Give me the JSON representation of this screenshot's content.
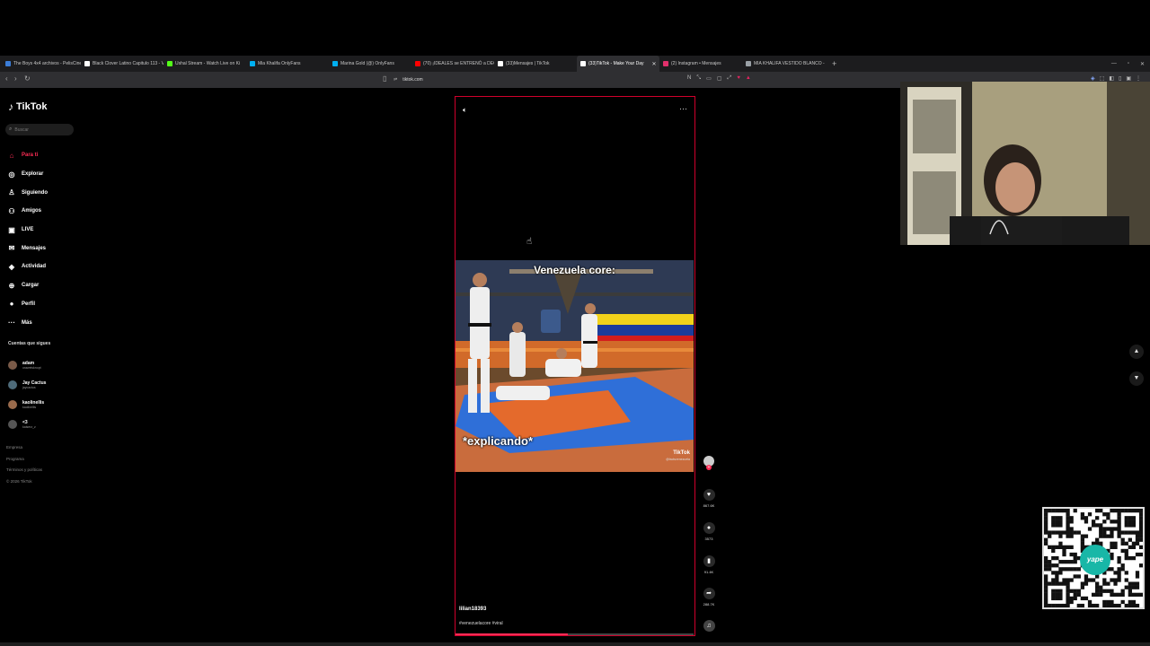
{
  "browser": {
    "tabs": [
      {
        "label": "The Boys 4x4 archivos - PelisCine HD",
        "color": "#3b7dd8",
        "active": false
      },
      {
        "label": "Black Clover Latino Capitulo 113 - Ve",
        "color": "#ffffff",
        "active": false
      },
      {
        "label": "Ushal Stream - Watch Live on Ki",
        "color": "#53fc18",
        "active": false
      },
      {
        "label": "Mia Khalifa OnlyFans",
        "color": "#00aff0",
        "active": false
      },
      {
        "label": "Marina Gold (@) OnlyFans",
        "color": "#00aff0",
        "active": false
      },
      {
        "label": "(70) ¡IDEALES se ENTRENÓ a DEO...",
        "color": "#ff0000",
        "active": false
      },
      {
        "label": "(33)Mensajes | TikTok",
        "color": "#ffffff",
        "active": false
      },
      {
        "label": "(33)TikTok - Make Your Day",
        "color": "#ffffff",
        "active": true
      },
      {
        "label": "(2) Instagram • Mensajes",
        "color": "#e1306c",
        "active": false
      },
      {
        "label": "MIA KHALIFA VESTIDO BLANCO - B...",
        "color": "#9aa0a6",
        "active": false
      }
    ],
    "url": "tiktok.com"
  },
  "tiktok": {
    "logo": "TikTok",
    "search_placeholder": "Buscar",
    "nav": [
      {
        "label": "Para ti",
        "icon": "home-icon",
        "active": true
      },
      {
        "label": "Explorar",
        "icon": "compass-icon",
        "active": false
      },
      {
        "label": "Siguiendo",
        "icon": "following-icon",
        "active": false
      },
      {
        "label": "Amigos",
        "icon": "friends-icon",
        "active": false
      },
      {
        "label": "LIVE",
        "icon": "live-icon",
        "active": false
      },
      {
        "label": "Mensajes",
        "icon": "messages-icon",
        "active": false
      },
      {
        "label": "Actividad",
        "icon": "activity-icon",
        "active": false
      },
      {
        "label": "Cargar",
        "icon": "upload-icon",
        "active": false
      },
      {
        "label": "Perfil",
        "icon": "profile-icon",
        "active": false
      },
      {
        "label": "Más",
        "icon": "more-icon",
        "active": false
      }
    ],
    "following_title": "Cuentas que sigues",
    "following": [
      {
        "name": "adam",
        "handle": "oraweisknopt"
      },
      {
        "name": "Jay Cactus",
        "handle": "jaycactus"
      },
      {
        "name": "kaolinellis",
        "handle": "kaolinellis"
      },
      {
        "name": "<3",
        "handle": "kaiserz_z"
      }
    ],
    "footer": [
      "Empresa",
      "Programa",
      "Términos y políticas",
      "© 2026 TikTok"
    ]
  },
  "video": {
    "top_text": "Venezuela core:",
    "bottom_text": "*explicando*",
    "watermark": "TikTok",
    "watermark_handle": "@factsvenezuela",
    "author": "lilian18393",
    "caption": "#venezuelacore #viral",
    "progress": 0.47,
    "likes": "867.6K",
    "comments": "3573",
    "saves": "91.4K",
    "shares": "288.7K"
  },
  "colors": {
    "accent": "#fe2c55",
    "player_border": "#d0002c"
  }
}
